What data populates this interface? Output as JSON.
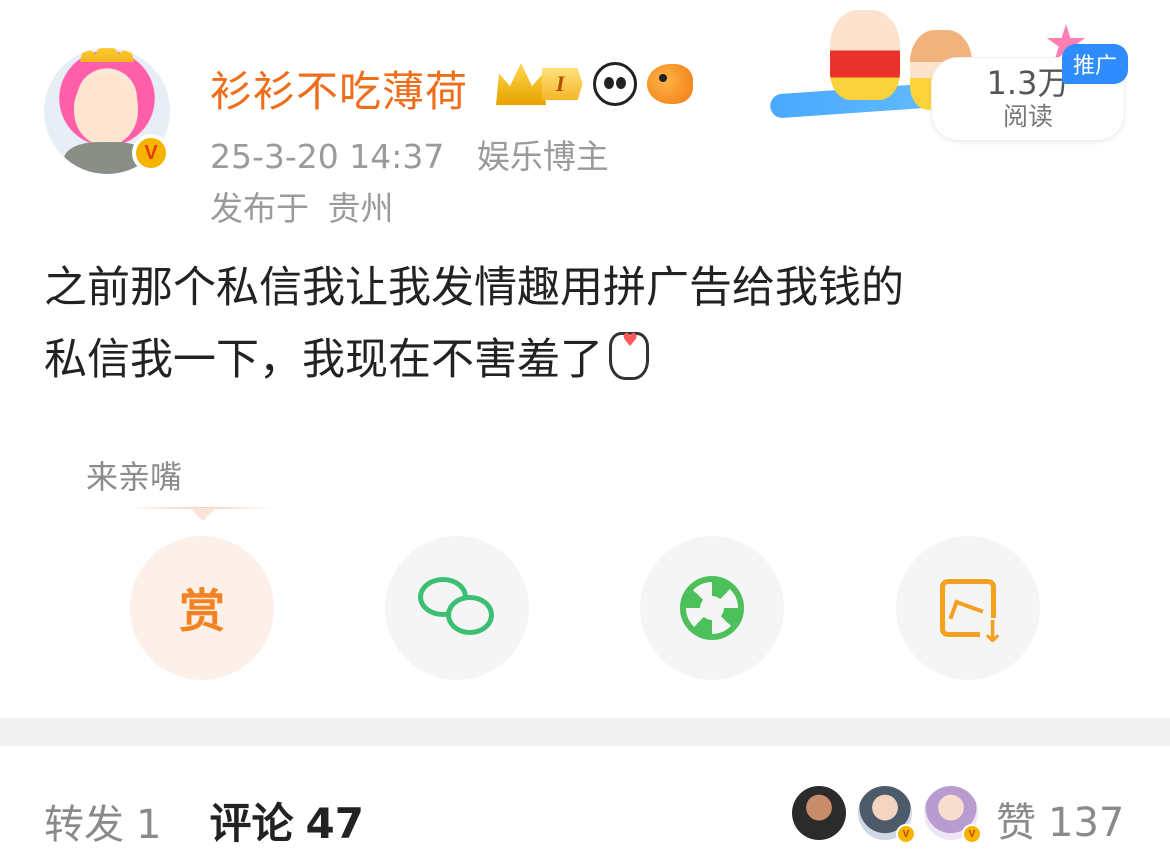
{
  "author": {
    "username": "衫衫不吃薄荷",
    "vip_level": "I",
    "verified_mark": "V",
    "timestamp": "25-3-20 14:37",
    "role": "娱乐博主",
    "location_prefix": "发布于",
    "location": "贵州",
    "badge_icons": [
      "crown-vip-icon",
      "panda-icon",
      "fish-icon"
    ]
  },
  "read_card": {
    "count": "1.3万",
    "label": "阅读",
    "promo_tag": "推广"
  },
  "post": {
    "line1": "之前那个私信我让我发情趣用拼广告给我钱的",
    "line2": "私信我一下，我现在不害羞了",
    "emoji": "heart-hand-icon"
  },
  "reward_hint": "来亲嘴",
  "actions": {
    "reward_label": "赏",
    "items": [
      "reward-button",
      "wechat-share-button",
      "moments-share-button",
      "save-image-button"
    ]
  },
  "stats": {
    "repost_label": "转发",
    "repost_count": "1",
    "comment_label": "评论",
    "comment_count": "47",
    "like_label": "赞",
    "like_count": "137",
    "liker_verified_mark": "V"
  },
  "colors": {
    "username": "#ef6e1c",
    "promo": "#2f8cff",
    "reward": "#f58220",
    "wechat": "#3dbf73",
    "moments": "#4cc05a",
    "save": "#f5a020"
  }
}
